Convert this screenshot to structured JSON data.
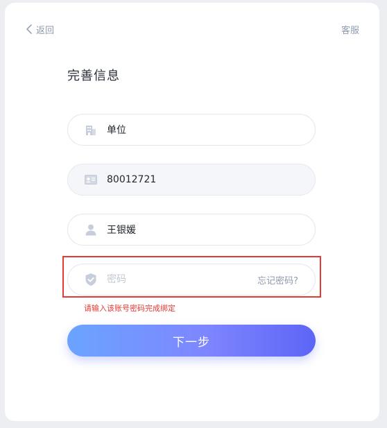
{
  "header": {
    "back_label": "返回",
    "service_label": "客服"
  },
  "page_title": "完善信息",
  "form": {
    "unit": {
      "value": "单位",
      "icon": "building-icon"
    },
    "account": {
      "value": "80012721",
      "icon": "id-card-icon"
    },
    "name": {
      "value": "王银媛",
      "icon": "user-icon"
    },
    "password": {
      "value": "",
      "placeholder": "密码",
      "icon": "shield-check-icon",
      "forgot_label": "忘记密码?"
    }
  },
  "error_message": "请输入该账号密码完成绑定",
  "next_button_label": "下一步",
  "colors": {
    "accent_start": "#6aa4ff",
    "accent_end": "#5d65f6",
    "error": "#e53935",
    "muted_text": "#8f9aae"
  }
}
